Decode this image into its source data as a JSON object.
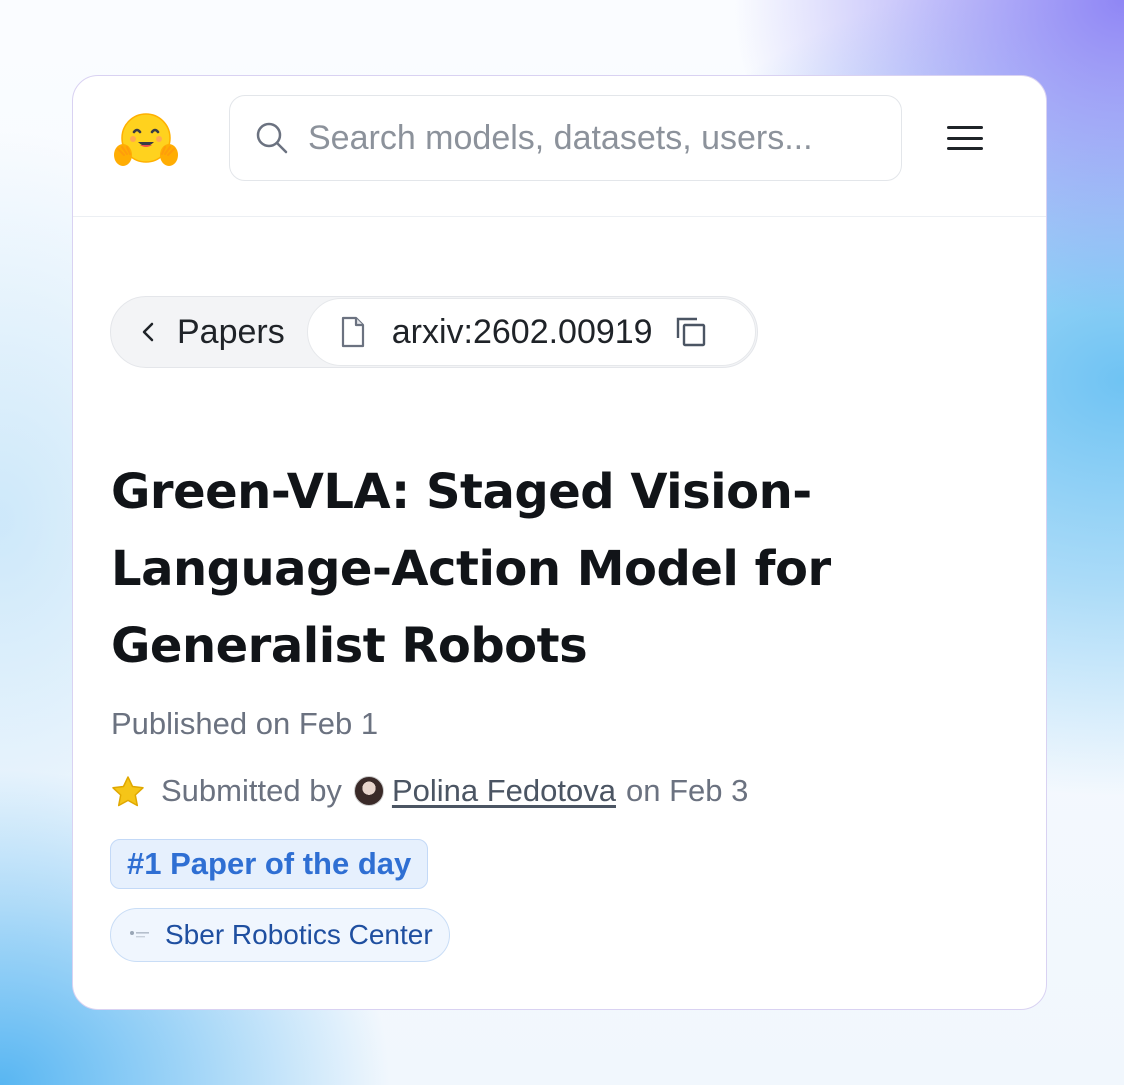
{
  "header": {
    "logo": "hugging-face-emoji-icon",
    "search_placeholder": "Search models, datasets, users...",
    "menu_icon": "hamburger-menu-icon"
  },
  "breadcrumb": {
    "back_label": "Papers",
    "paper_id": "arxiv:2602.00919"
  },
  "paper": {
    "title": "Green-VLA: Staged Vision-Language-Action Model for Generalist Robots",
    "published": "Published on Feb 1",
    "submitted_prefix": "Submitted by",
    "submitter": "Polina Fedotova",
    "submitted_suffix": "on Feb 3",
    "badge": "#1 Paper of the day",
    "organization": "Sber Robotics Center"
  },
  "colors": {
    "accent_blue": "#2f6fd3",
    "badge_bg": "#e6f0fd",
    "star": "#f5c518"
  }
}
